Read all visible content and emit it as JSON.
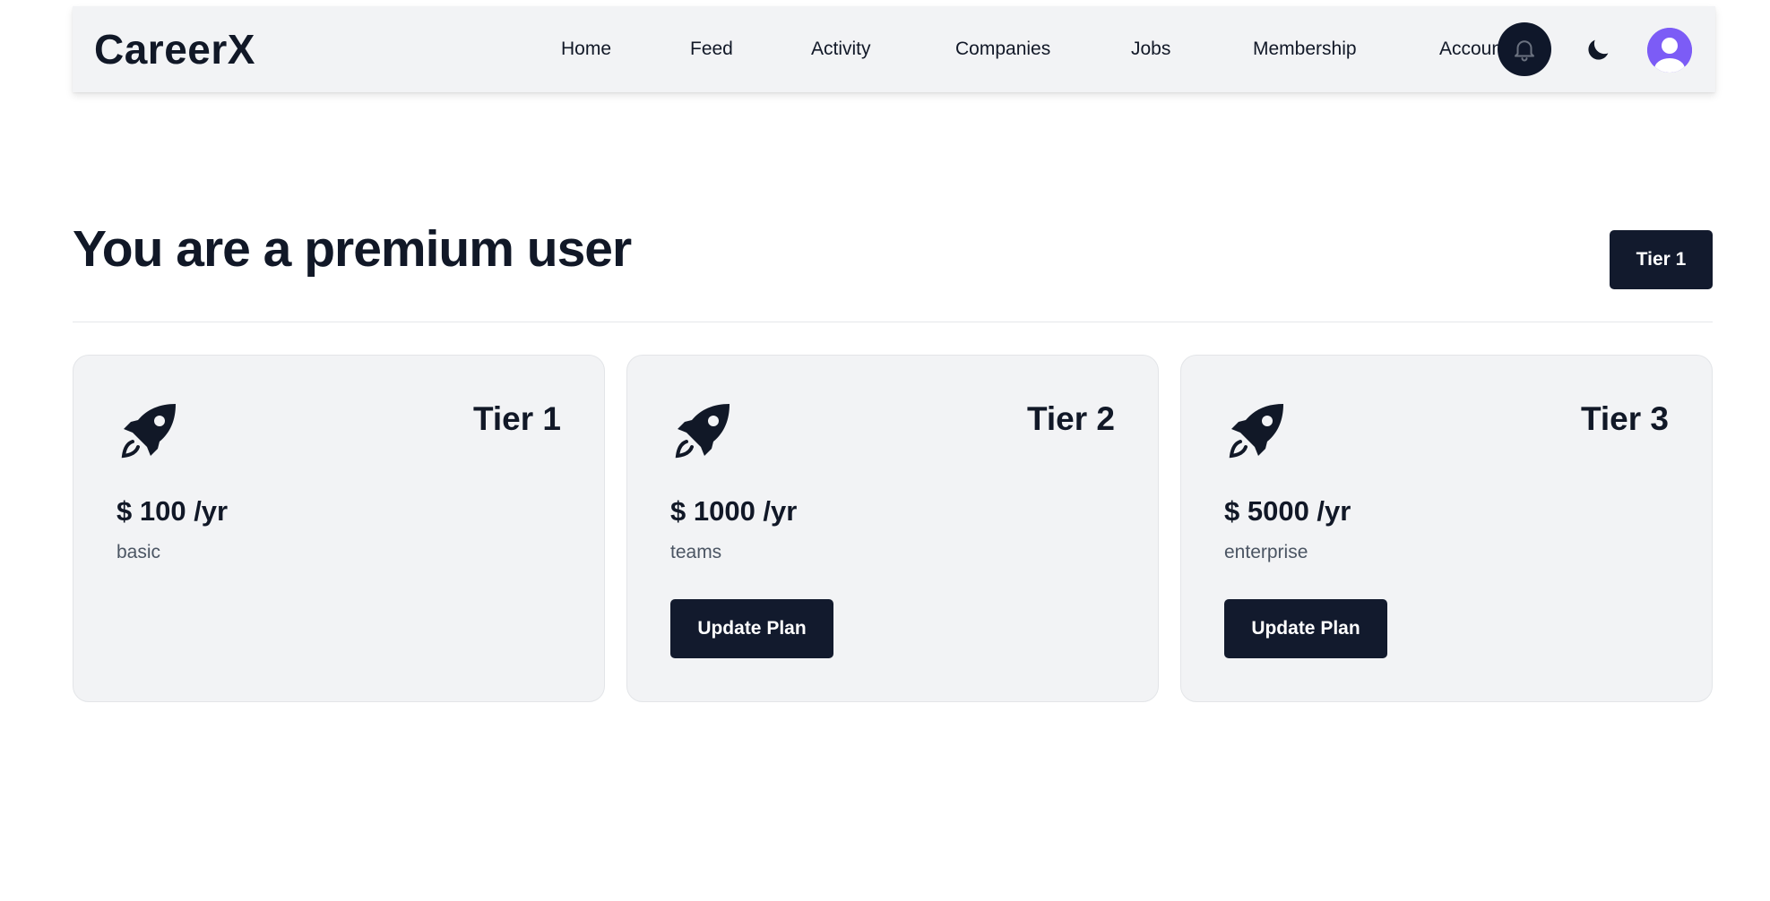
{
  "nav": {
    "brand": "CareerX",
    "links": [
      {
        "label": "Home"
      },
      {
        "label": "Feed"
      },
      {
        "label": "Activity"
      },
      {
        "label": "Companies"
      },
      {
        "label": "Jobs"
      },
      {
        "label": "Membership"
      },
      {
        "label": "Account"
      }
    ],
    "icons": {
      "notification": "bell-icon",
      "theme": "moon-icon",
      "avatar": "user-avatar-icon"
    }
  },
  "header": {
    "title": "You are a premium user",
    "current_tier": "Tier 1"
  },
  "plans": [
    {
      "tier": "Tier 1",
      "price": "$ 100 /yr",
      "name": "basic",
      "icon": "rocket-icon",
      "action": null
    },
    {
      "tier": "Tier 2",
      "price": "$ 1000 /yr",
      "name": "teams",
      "icon": "rocket-icon",
      "action": "Update Plan"
    },
    {
      "tier": "Tier 3",
      "price": "$ 5000 /yr",
      "name": "enterprise",
      "icon": "rocket-icon",
      "action": "Update Plan"
    }
  ],
  "colors": {
    "primary": "#121a2d",
    "navbar_bg": "#f2f3f5",
    "card_bg": "#f2f3f5",
    "avatar": "#7c5cf6",
    "text": "#111827",
    "muted_text": "#4b5563"
  }
}
